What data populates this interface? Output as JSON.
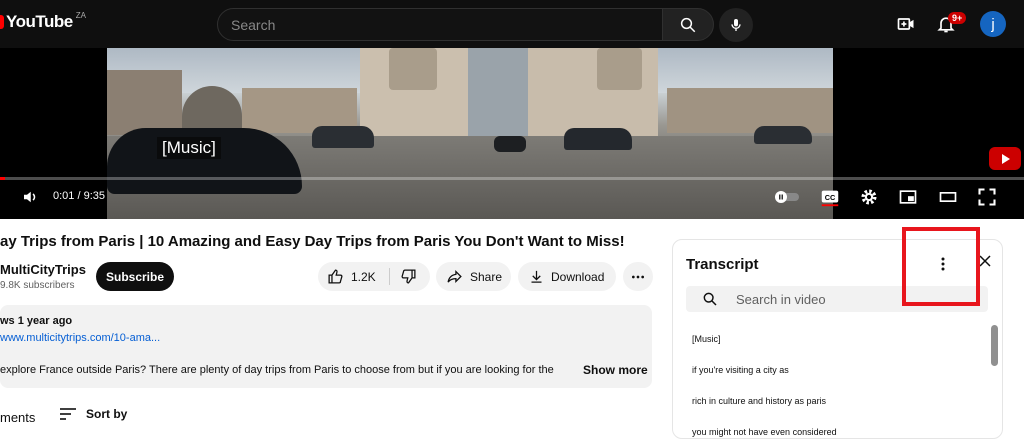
{
  "header": {
    "logo_text": "YouTube",
    "country_code": "ZA",
    "search_placeholder": "Search",
    "notifications_badge": "9+",
    "avatar_letter": "j"
  },
  "player": {
    "caption": "[Music]",
    "time": "0:01 / 9:35",
    "progress": 0.002
  },
  "video": {
    "title": "ay Trips from Paris | 10 Amazing and Easy Day Trips from Paris You Don't Want to Miss!",
    "channel_name": "MultiCityTrips",
    "subscribers": "9.8K subscribers",
    "subscribe_label": "Subscribe",
    "likes": "1.2K",
    "share_label": "Share",
    "download_label": "Download"
  },
  "description": {
    "meta": "ws  1 year ago",
    "link": "www.multicitytrips.com/10-ama...",
    "text": "explore France outside Paris? There are plenty of day trips from Paris to choose from but if you are looking for the",
    "show_more": "Show more"
  },
  "comments": {
    "label": "ments",
    "sort_label": "Sort by"
  },
  "transcript": {
    "title": "Transcript",
    "search_placeholder": "Search in video",
    "lines": [
      "[Music]",
      "if you're visiting a city as",
      "rich in culture and history as paris",
      "you might not have even considered"
    ]
  },
  "colors": {
    "brand_red": "#ff0000",
    "highlight": "#e8161d",
    "link": "#065fd4",
    "avatar": "#1565c0"
  }
}
